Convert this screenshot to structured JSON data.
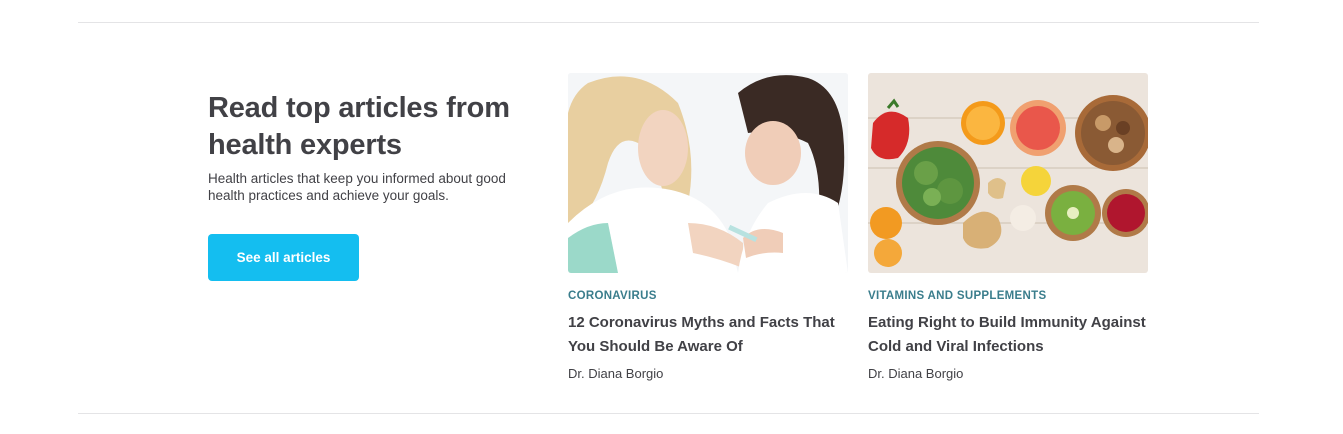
{
  "section": {
    "heading": "Read top articles from health experts",
    "description": "Health articles that keep you informed about good health practices and achieve your goals.",
    "cta_label": "See all articles"
  },
  "articles": [
    {
      "category": "CORONAVIRUS",
      "title": "12 Coronavirus Myths and Facts That You Should Be Aware Of",
      "author": "Dr. Diana Borgio",
      "image": "doctor-giving-vaccine-photo"
    },
    {
      "category": "VITAMINS AND SUPPLEMENTS",
      "title": "Eating Right to Build Immunity Against Cold and Viral Infections",
      "author": "Dr. Diana Borgio",
      "image": "fruits-and-vegetables-photo"
    }
  ],
  "colors": {
    "accent": "#14bef0",
    "category": "#3a7d8c",
    "text": "#414146",
    "divider": "#e4e4e6"
  }
}
